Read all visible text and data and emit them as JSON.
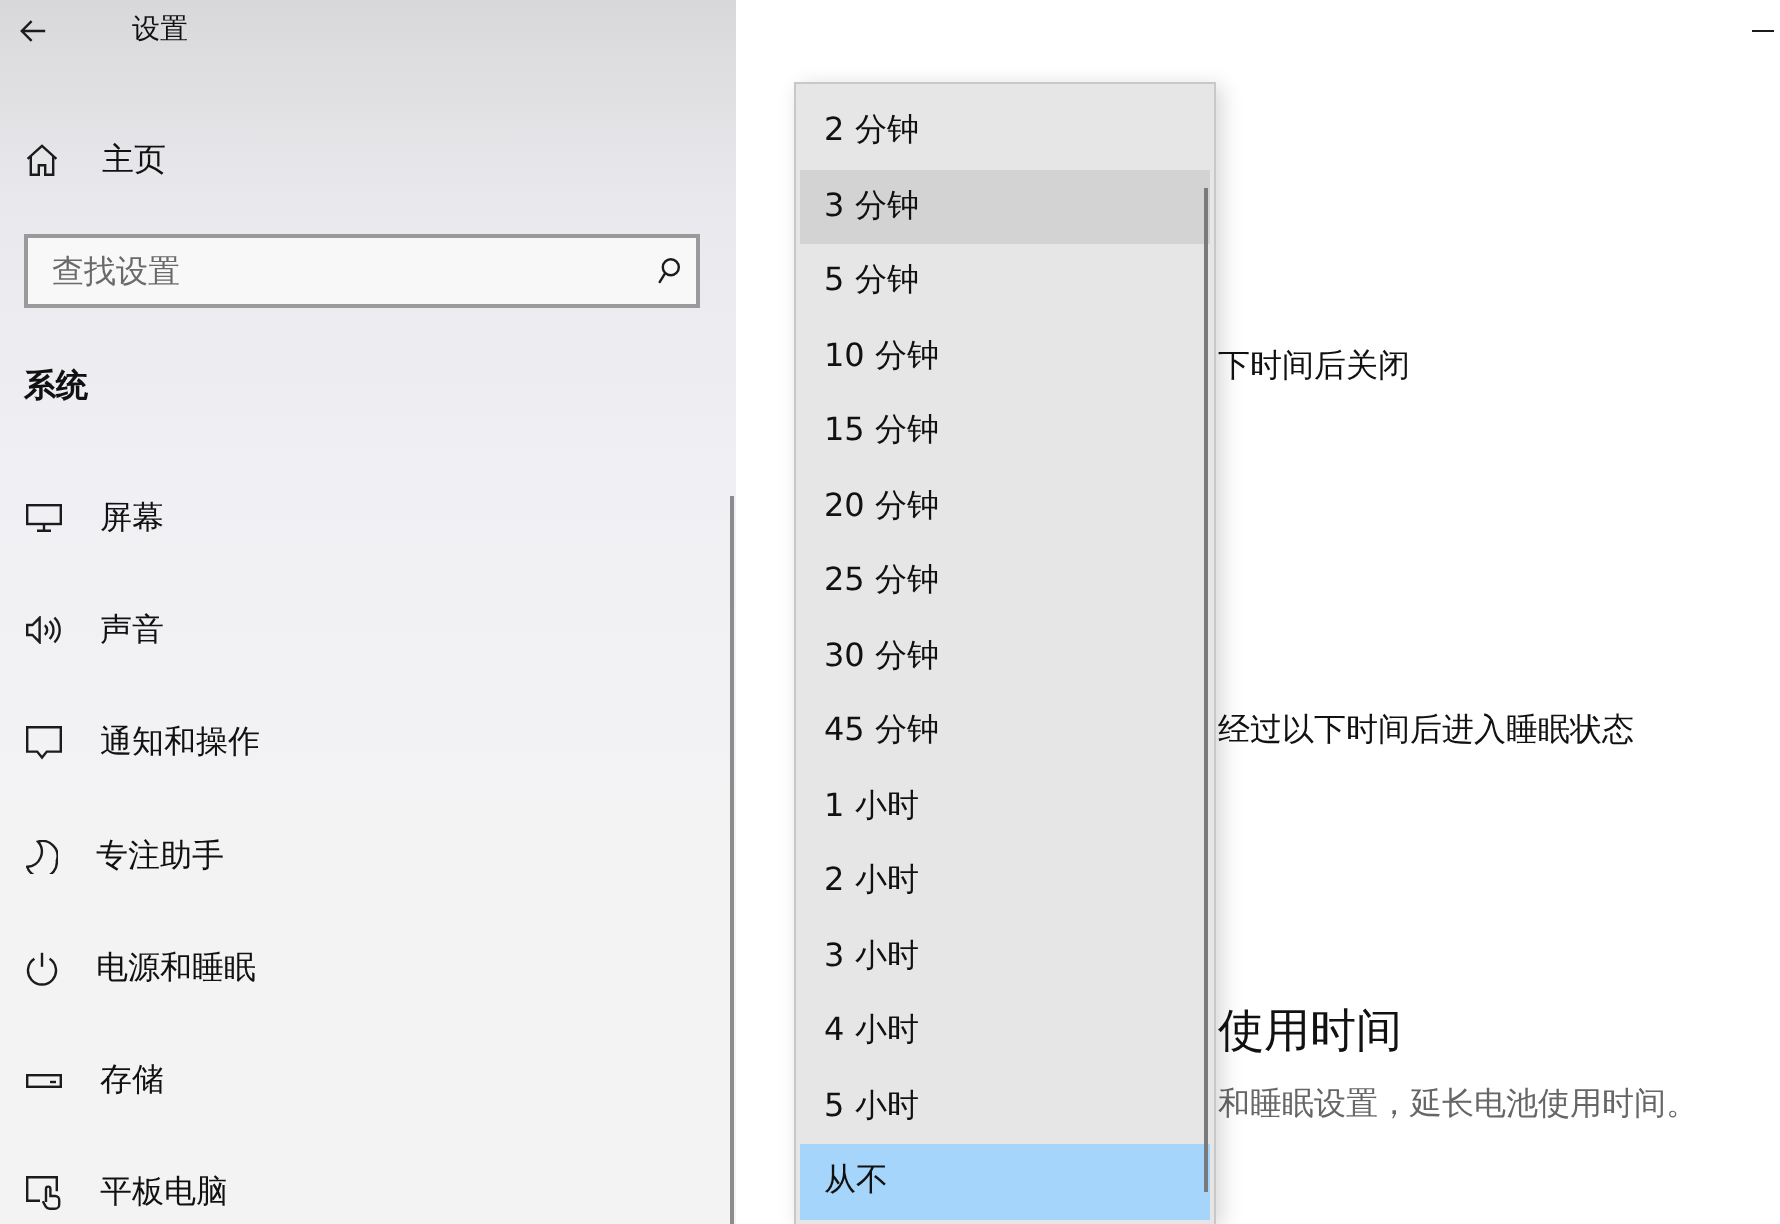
{
  "window": {
    "title": "设置"
  },
  "sidebar": {
    "home": "主页",
    "search": {
      "placeholder": "查找设置"
    },
    "section": "系统",
    "items": [
      {
        "label": "屏幕"
      },
      {
        "label": "声音"
      },
      {
        "label": "通知和操作"
      },
      {
        "label": "专注助手"
      },
      {
        "label": "电源和睡眠"
      },
      {
        "label": "存储"
      },
      {
        "label": "平板电脑"
      }
    ]
  },
  "content": {
    "screen_timeout_label": "下时间后关闭",
    "sleep_timeout_label": "经过以下时间后进入睡眠状态",
    "battery_heading": "使用时间",
    "battery_description": "和睡眠设置，延长电池使用时间。"
  },
  "dropdown": {
    "options": [
      {
        "label": "2 分钟",
        "selected": false,
        "hovered": false
      },
      {
        "label": "3 分钟",
        "selected": false,
        "hovered": true
      },
      {
        "label": "5 分钟",
        "selected": false,
        "hovered": false
      },
      {
        "label": "10 分钟",
        "selected": false,
        "hovered": false
      },
      {
        "label": "15 分钟",
        "selected": false,
        "hovered": false
      },
      {
        "label": "20 分钟",
        "selected": false,
        "hovered": false
      },
      {
        "label": "25 分钟",
        "selected": false,
        "hovered": false
      },
      {
        "label": "30 分钟",
        "selected": false,
        "hovered": false
      },
      {
        "label": "45 分钟",
        "selected": false,
        "hovered": false
      },
      {
        "label": "1 小时",
        "selected": false,
        "hovered": false
      },
      {
        "label": "2 小时",
        "selected": false,
        "hovered": false
      },
      {
        "label": "3 小时",
        "selected": false,
        "hovered": false
      },
      {
        "label": "4 小时",
        "selected": false,
        "hovered": false
      },
      {
        "label": "5 小时",
        "selected": false,
        "hovered": false
      },
      {
        "label": "从不",
        "selected": true,
        "hovered": false
      }
    ]
  }
}
